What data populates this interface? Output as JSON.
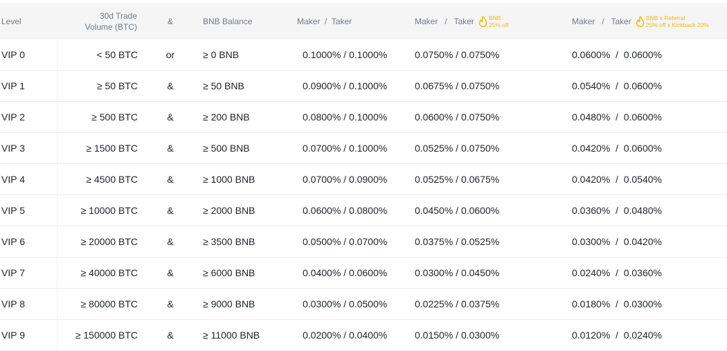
{
  "header": {
    "level": "Level",
    "volume_line1": "30d Trade",
    "volume_line2": "Volume (BTC)",
    "amp": "&",
    "bnb_balance": "BNB Balance",
    "fee1": "Maker  /  Taker",
    "fee2": "Maker   /   Taker",
    "fee2_promo_line1": "BNB",
    "fee2_promo_line2": "25% off",
    "fee3": "Maker   /   Taker",
    "fee3_promo_line1": "BNB x Referral",
    "fee3_promo_line2": "25% off x Kickback 20%",
    "flame_icon": "flame-icon",
    "accent_color": "#f0b90b"
  },
  "rows": [
    {
      "level": "VIP 0",
      "volume": "< 50 BTC",
      "op": "or",
      "bnb": "≥ 0 BNB",
      "fee1": "0.1000% / 0.1000%",
      "fee2": "0.0750% / 0.0750%",
      "fee3": "0.0600%  /  0.0600%"
    },
    {
      "level": "VIP 1",
      "volume": "≥ 50 BTC",
      "op": "&",
      "bnb": "≥ 50 BNB",
      "fee1": "0.0900% / 0.1000%",
      "fee2": "0.0675% / 0.0750%",
      "fee3": "0.0540%  /  0.0600%"
    },
    {
      "level": "VIP 2",
      "volume": "≥ 500 BTC",
      "op": "&",
      "bnb": "≥ 200 BNB",
      "fee1": "0.0800% / 0.1000%",
      "fee2": "0.0600% / 0.0750%",
      "fee3": "0.0480%  /  0.0600%"
    },
    {
      "level": "VIP 3",
      "volume": "≥ 1500 BTC",
      "op": "&",
      "bnb": "≥ 500 BNB",
      "fee1": "0.0700% / 0.1000%",
      "fee2": "0.0525% / 0.0750%",
      "fee3": "0.0420%  /  0.0600%"
    },
    {
      "level": "VIP 4",
      "volume": "≥ 4500 BTC",
      "op": "&",
      "bnb": "≥ 1000 BNB",
      "fee1": "0.0700% / 0.0900%",
      "fee2": "0.0525% / 0.0675%",
      "fee3": "0.0420%  /  0.0540%"
    },
    {
      "level": "VIP 5",
      "volume": "≥ 10000 BTC",
      "op": "&",
      "bnb": "≥ 2000 BNB",
      "fee1": "0.0600% / 0.0800%",
      "fee2": "0.0450% / 0.0600%",
      "fee3": "0.0360%  /  0.0480%"
    },
    {
      "level": "VIP 6",
      "volume": "≥ 20000 BTC",
      "op": "&",
      "bnb": "≥ 3500 BNB",
      "fee1": "0.0500% / 0.0700%",
      "fee2": "0.0375% / 0.0525%",
      "fee3": "0.0300%  /  0.0420%"
    },
    {
      "level": "VIP 7",
      "volume": "≥ 40000 BTC",
      "op": "&",
      "bnb": "≥ 6000 BNB",
      "fee1": "0.0400% / 0.0600%",
      "fee2": "0.0300% / 0.0450%",
      "fee3": "0.0240%  /  0.0360%"
    },
    {
      "level": "VIP 8",
      "volume": "≥ 80000 BTC",
      "op": "&",
      "bnb": "≥ 9000 BNB",
      "fee1": "0.0300% / 0.0500%",
      "fee2": "0.0225% / 0.0375%",
      "fee3": "0.0180%  /  0.0300%"
    },
    {
      "level": "VIP 9",
      "volume": "≥ 150000 BTC",
      "op": "&",
      "bnb": "≥ 11000 BNB",
      "fee1": "0.0200% / 0.0400%",
      "fee2": "0.0150% / 0.0300%",
      "fee3": "0.0120%  /  0.0240%"
    }
  ]
}
